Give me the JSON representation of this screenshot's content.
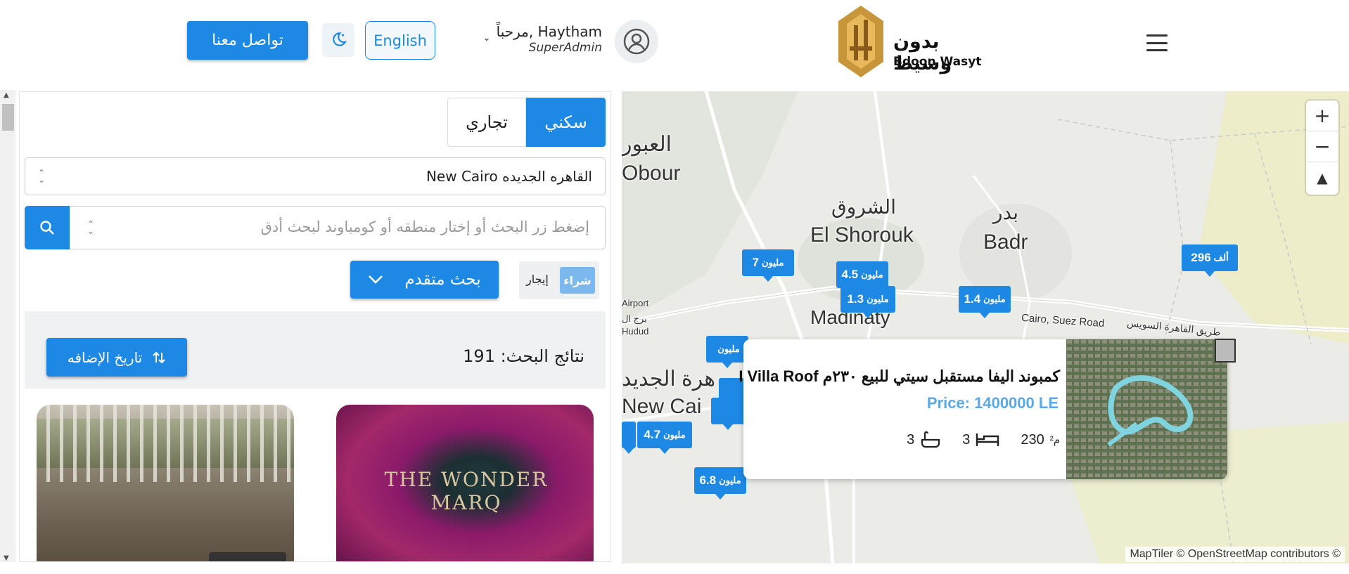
{
  "header": {
    "contact_label": "تواصل معنا",
    "lang_label": "English",
    "user_greeting": "مرحباً, Haytham",
    "user_role": "SuperAdmin",
    "logo_ar": "بدون وسيط",
    "logo_en": "Bdoon Wasyt",
    "icons": [
      "moon-icon",
      "user-icon",
      "chevron-down-icon",
      "menu-icon"
    ]
  },
  "search": {
    "tabs": [
      {
        "label": "سكني",
        "active": true
      },
      {
        "label": "تجاري",
        "active": false
      }
    ],
    "city_value": "New Cairo القاهره الجديده",
    "placeholder": "إضغط زر البحث أو إختار منطقه أو كومباوند لبحث أدق",
    "advanced_label": "بحث متقدم",
    "buy_label": "شراء",
    "rent_label": "إيجار"
  },
  "results": {
    "count_label": "نتائج البحث: 191",
    "sort_label": "تاريخ الإضافه",
    "card2_text": "THE WONDER MARQ"
  },
  "map": {
    "labels": {
      "obour_ar": "العبور",
      "obour_en": "Obour",
      "shorouk_ar": "الشروق",
      "shorouk_en": "El Shorouk",
      "badr_ar": "بدر",
      "badr_en": "Badr",
      "madinaty": "Madinaty",
      "airport": "Airport",
      "hudud_ar": "برج ال",
      "hudud_en": "Hudud",
      "suez_road": "Cairo, Suez Road",
      "suez_road_ar": "طريق القاهرة السويس",
      "newcairo_ar": "هرة الجديد",
      "newcairo_en": "New Cai"
    },
    "markers": [
      {
        "num": "7",
        "unit": "مليون"
      },
      {
        "num": "4.5",
        "unit": "مليون"
      },
      {
        "num": "1.3",
        "unit": "مليون"
      },
      {
        "num": "1.4",
        "unit": "مليون"
      },
      {
        "num": "296",
        "unit": "ألف"
      },
      {
        "num": "",
        "unit": "مليون"
      },
      {
        "num": "4.7",
        "unit": "مليون"
      },
      {
        "num": "6.8",
        "unit": "مليون"
      }
    ],
    "popup": {
      "title": "I Villa Roof كمبوند اليفا مستقبل سيتي للبيع ٢٣٠م",
      "price": "Price: 1400000 LE",
      "area": "230",
      "area_unit": "م²",
      "baths": "3",
      "beds": "3"
    },
    "attribution": "MapTiler © OpenStreetMap contributors ©",
    "zoom_in": "+",
    "zoom_out": "−"
  }
}
